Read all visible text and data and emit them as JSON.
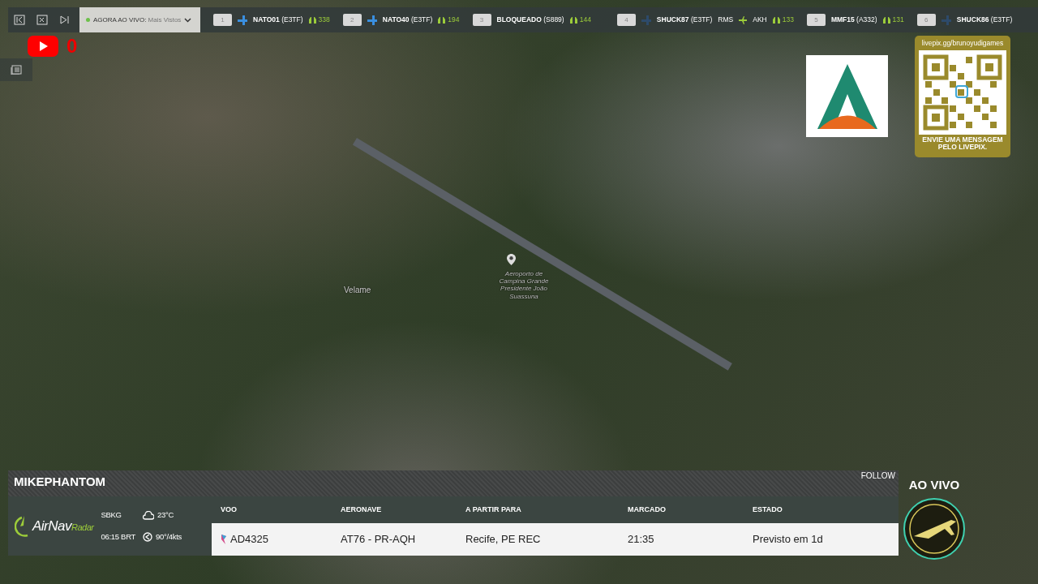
{
  "top_bar": {
    "live_selector": {
      "label": "AGORA AO VIVO:",
      "value": "Mais Vistos",
      "live": true
    },
    "flights": [
      {
        "rank": "1",
        "callsign": "NATO01",
        "type": "(E3TF)",
        "kind": "icon",
        "viewers": "338"
      },
      {
        "rank": "2",
        "callsign": "NATO40",
        "type": "(E3TF)",
        "kind": "icon",
        "viewers": "194"
      },
      {
        "rank": "3",
        "callsign": "BLOQUEADO",
        "type": "(S889)",
        "kind": "plain",
        "viewers": "144"
      },
      {
        "rank": "4",
        "callsign": "SHUCK87",
        "type": "(E3TF)",
        "kind": "faded",
        "route": {
          "from": "RMS",
          "to": "AKH"
        },
        "viewers": "133"
      },
      {
        "rank": "5",
        "callsign": "MMF15",
        "type": "(A332)",
        "kind": "plain",
        "viewers": "131"
      },
      {
        "rank": "6",
        "callsign": "SHUCK86",
        "type": "(E3TF)",
        "kind": "faded"
      }
    ]
  },
  "youtube": {
    "count": "0"
  },
  "map": {
    "labels": [
      {
        "kind": "place",
        "text": "Velame"
      },
      {
        "kind": "airport",
        "text": "Aeroporto de Campina Grande Presidente João Suassuna"
      }
    ]
  },
  "livepix": {
    "url": "livepix.gg/brunoyudigames",
    "message": "ENVIE UMA MENSAGEM PELO LIVEPIX."
  },
  "flight_panel": {
    "streamer": "MIKEPHANTOM",
    "follow": "FOLLOW",
    "brand": {
      "name": "AirNav",
      "suffix": "Radar"
    },
    "airport": "SBKG",
    "time": "06:15 BRT",
    "temperature": "23°C",
    "wind": "90°/4kts",
    "table": {
      "columns": [
        "VOO",
        "AERONAVE",
        "A PARTIR PARA",
        "MARCADO",
        "ESTADO"
      ],
      "rows": [
        [
          "AD4325",
          "AT76 - PR-AQH",
          "Recife, PE REC",
          "21:35",
          "Previsto em 1d"
        ]
      ]
    }
  },
  "live_badge": {
    "text": "AO VIVO"
  }
}
